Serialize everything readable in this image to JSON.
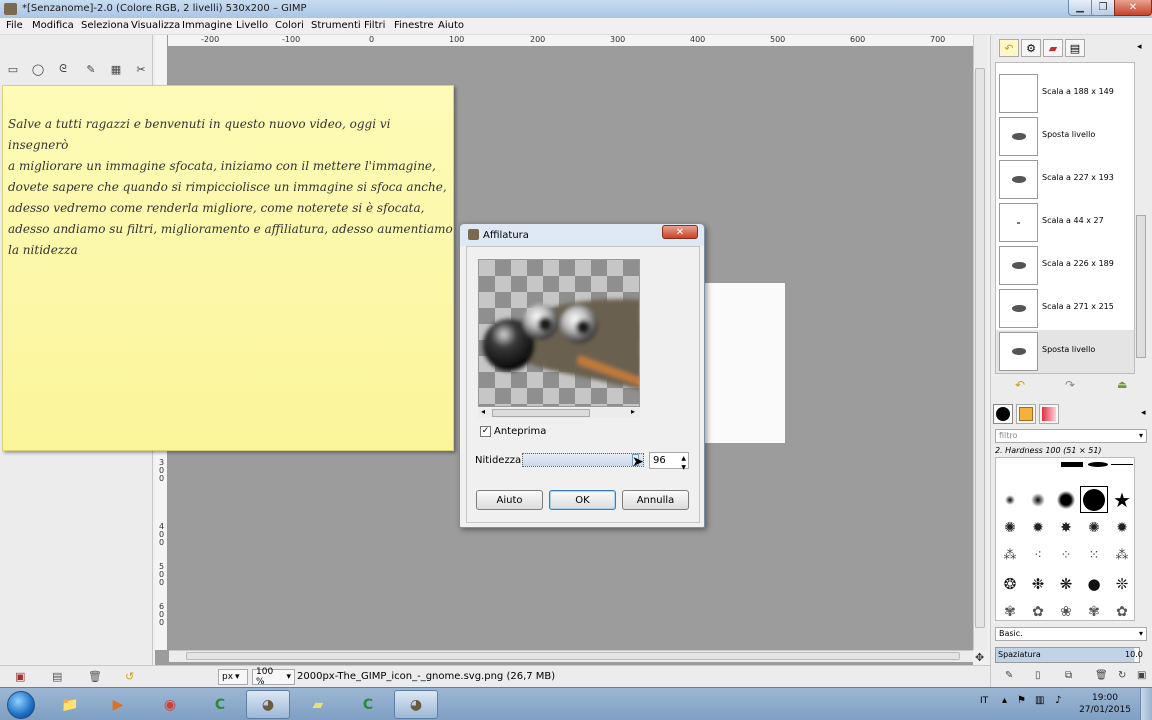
{
  "window": {
    "title": "*[Senzanome]-2.0 (Colore RGB, 2 livelli) 530x200 – GIMP",
    "minimize_icon": "minimize-icon",
    "maximize_icon": "maximize-icon",
    "close_icon": "close-icon"
  },
  "menu": [
    "File",
    "Modifica",
    "Seleziona",
    "Visualizza",
    "Immagine",
    "Livello",
    "Colori",
    "Strumenti",
    "Filtri",
    "Finestre",
    "Aiuto"
  ],
  "ruler_top": [
    "-200",
    "-100",
    "0",
    "100",
    "200",
    "300",
    "400",
    "500",
    "600",
    "700"
  ],
  "ruler_left": [
    "3",
    "0",
    "0",
    "4",
    "0",
    "0",
    "5",
    "0",
    "0",
    "6",
    "0",
    "0"
  ],
  "note": {
    "lines": [
      "Salve a tutti ragazzi e benvenuti in questo nuovo video, oggi vi insegnerò",
      "a migliorare un immagine sfocata, iniziamo con il mettere l'immagine,",
      "dovete sapere che quando si rimpicciolisce un immagine si sfoca anche,",
      "adesso vedremo come renderla migliore, come noterete si è sfocata,",
      "adesso andiamo su filtri, miglioramento e affiliatura, adesso aumentiamo",
      "la nitidezza"
    ]
  },
  "dialog": {
    "title": "Affilatura",
    "preview_label": "Anteprima",
    "preview_checked": true,
    "sharpness_label": "Nitidezza:",
    "sharpness_value": "96",
    "sharpness_fraction": 0.96,
    "buttons": {
      "help": "Aiuto",
      "ok": "OK",
      "cancel": "Annulla"
    }
  },
  "statusbar": {
    "unit": "px",
    "zoom": "100 %",
    "file": "2000px-The_GIMP_icon_-_gnome.svg.png (26,7 MB)"
  },
  "undo_history": [
    {
      "label": "Scala a 188 x 149",
      "thumb": "blank"
    },
    {
      "label": "Sposta livello",
      "thumb": "wilber"
    },
    {
      "label": "Scala a 227 x 193",
      "thumb": "wilber"
    },
    {
      "label": "Scala a 44 x 27",
      "thumb": "tiny"
    },
    {
      "label": "Scala a 226 x 189",
      "thumb": "wilber"
    },
    {
      "label": "Scala a 271 x 215",
      "thumb": "wilber"
    },
    {
      "label": "Sposta livello",
      "thumb": "wilber",
      "selected": true
    }
  ],
  "brushes": {
    "filter_placeholder": "filtro",
    "selected_name": "2. Hardness 100 (51 × 51)",
    "tag": "Basic.",
    "spacing_label": "Spaziatura",
    "spacing_value": "10.0"
  },
  "taskbar": {
    "language": "IT",
    "time": "19:00",
    "date": "27/01/2015"
  },
  "colors": {
    "note_bg": "#fbf59a",
    "canvas": "#9c9c9c",
    "taskbar": "#8aa8c9"
  }
}
